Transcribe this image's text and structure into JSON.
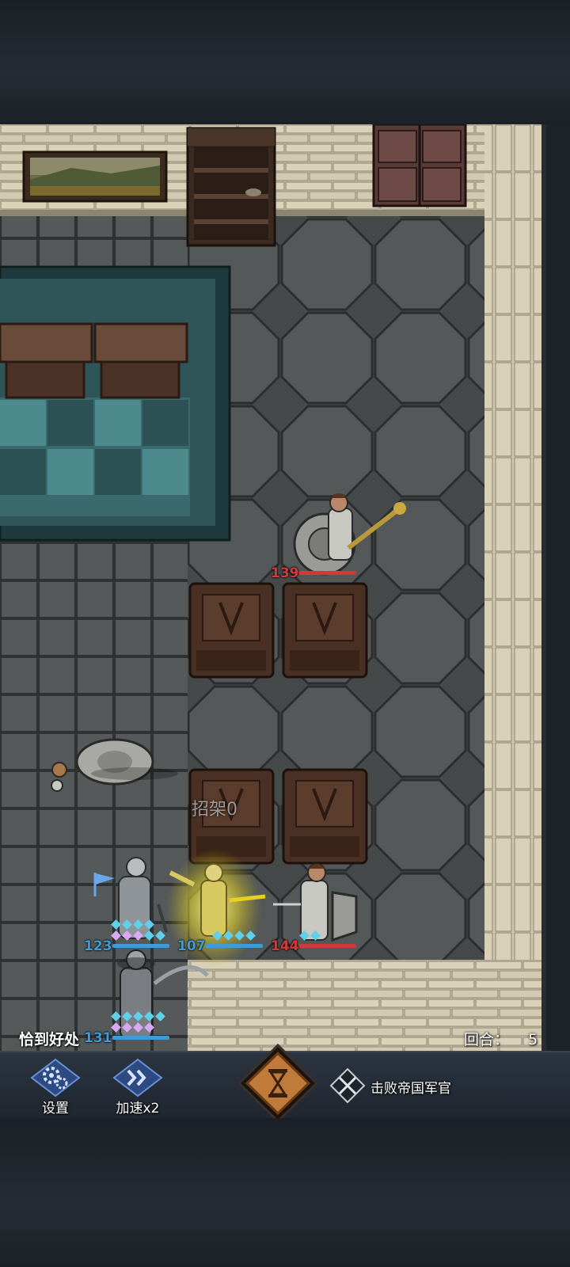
{
  "game": {
    "status_text": "恰到好处",
    "round_label": "回合：",
    "round_value": "5",
    "parry_text": "招架0"
  },
  "units": {
    "enemy_officer_hp": "139",
    "enemy_guard_hp": "144",
    "hero_one_hp": "123",
    "hero_two_hp": "107",
    "hero_three_hp": "131"
  },
  "bottom_bar": {
    "settings_label": "设置",
    "speed_label": "加速x2",
    "objective_text": "击败帝国军官"
  },
  "icons": {
    "settings": "gears-icon",
    "speed": "double-chevron-icon",
    "end_turn": "hourglass-icon",
    "objective": "crossed-swords-icon",
    "flag": "flag-icon"
  },
  "colors": {
    "enemy_hp": "#d23a3a",
    "ally_hp": "#3f9ad6",
    "armor_diamond": "#5fd0e8",
    "buff_diamond": "#d8a8f0"
  }
}
